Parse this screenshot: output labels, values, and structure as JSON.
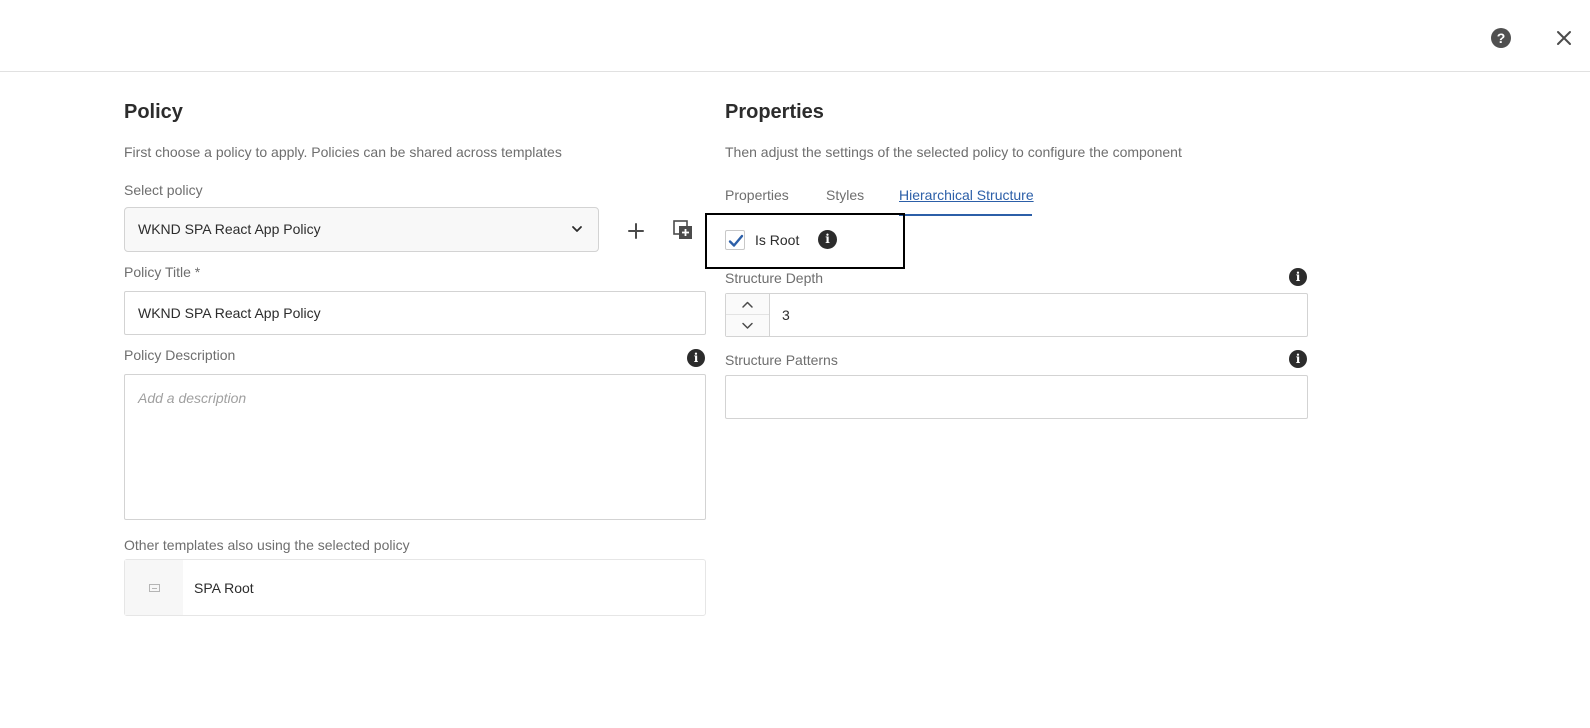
{
  "header": {
    "help_label": "?"
  },
  "policy": {
    "title": "Policy",
    "description": "First choose a policy to apply. Policies can be shared across templates",
    "select_label": "Select policy",
    "select_value": "WKND SPA React App Policy",
    "title_label": "Policy Title *",
    "title_value": "WKND SPA React App Policy",
    "desc_label": "Policy Description",
    "desc_placeholder": "Add a description",
    "other_templates_label": "Other templates also using the selected policy",
    "templates": [
      {
        "name": "SPA Root"
      }
    ]
  },
  "properties": {
    "title": "Properties",
    "description": "Then adjust the settings of the selected policy to configure the component",
    "tabs": [
      {
        "label": "Properties",
        "active": false
      },
      {
        "label": "Styles",
        "active": false
      },
      {
        "label": "Hierarchical Structure",
        "active": true
      }
    ],
    "is_root_label": "Is Root",
    "is_root_checked": true,
    "depth_label": "Structure Depth",
    "depth_value": "3",
    "patterns_label": "Structure Patterns",
    "patterns_value": ""
  },
  "icons": {
    "help": "help-icon",
    "close": "close-icon",
    "dropdown": "chevron-down-icon",
    "add": "plus-icon",
    "duplicate": "copy-add-icon",
    "info": "info-icon",
    "checkmark": "checkmark-icon",
    "stepper_up": "chevron-up-icon",
    "stepper_down": "chevron-down-icon",
    "template": "template-icon"
  },
  "colors": {
    "accent": "#2c5fa8",
    "text": "#2c2c2c",
    "muted": "#6e6e6e",
    "border": "#d3d3d3"
  }
}
